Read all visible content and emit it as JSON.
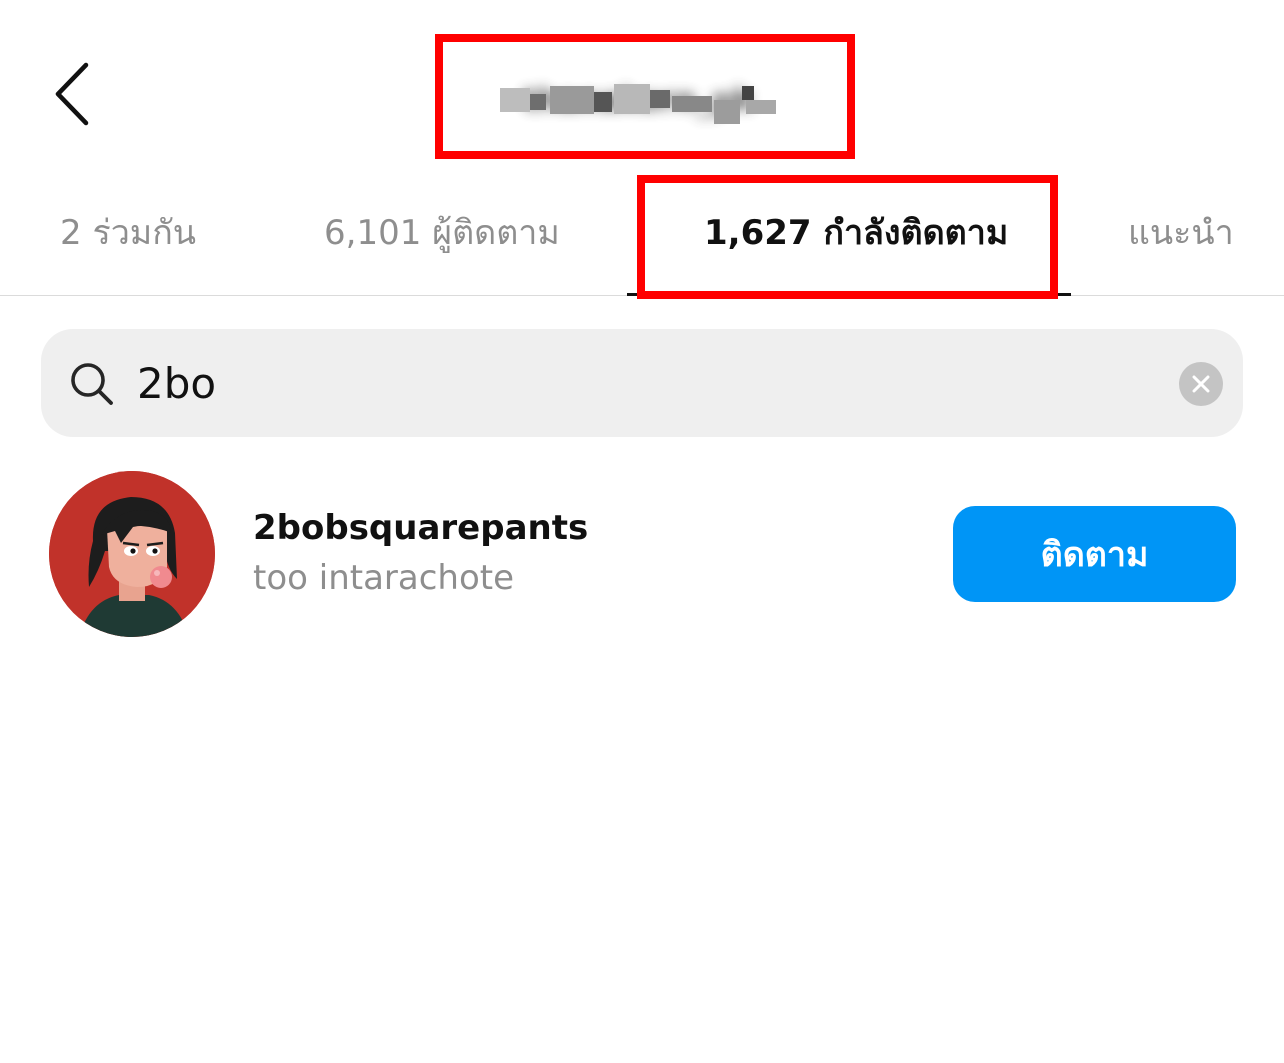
{
  "header": {
    "title": "thanakorn_pk",
    "back_icon": "chevron-left-icon"
  },
  "tabs": [
    {
      "label": "2 ร่วมกัน"
    },
    {
      "label": "6,101 ผู้ติดตาม"
    },
    {
      "label": "1,627 กำลังติดตาม"
    },
    {
      "label": "แนะนำ"
    }
  ],
  "search": {
    "value": "2bo",
    "icon": "search-icon",
    "clear_icon": "clear-icon"
  },
  "results": [
    {
      "username": "2bobsquarepants",
      "full_name": "too intarachote",
      "follow_label": "ติดตาม"
    }
  ],
  "colors": {
    "accent": "#0095f6",
    "highlight": "#ff0000",
    "avatar_bg": "#c1322a",
    "search_bg": "#efefef",
    "muted_text": "#8e8e8e"
  }
}
